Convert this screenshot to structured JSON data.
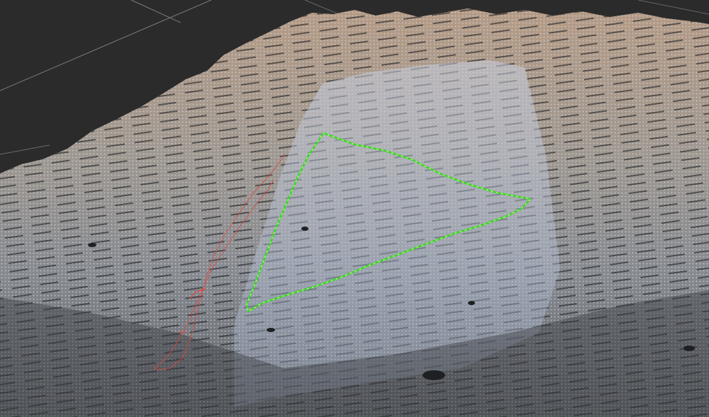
{
  "viewport": {
    "background": "#2b2b2b",
    "grid_color": "#7a7a7a"
  },
  "terrain": {
    "colors": {
      "far_high": "#b69a86",
      "mid": "#9b9ca5",
      "near_low": "#7e818a",
      "shadow": "#1e1f22",
      "highlight_strip": "#b9c6dc"
    }
  },
  "paths": [
    {
      "name": "green-triangle-path",
      "color": "#39d43a",
      "point_color": "#e6f25a"
    },
    {
      "name": "red-strip-path",
      "color": "#e0453c"
    }
  ]
}
